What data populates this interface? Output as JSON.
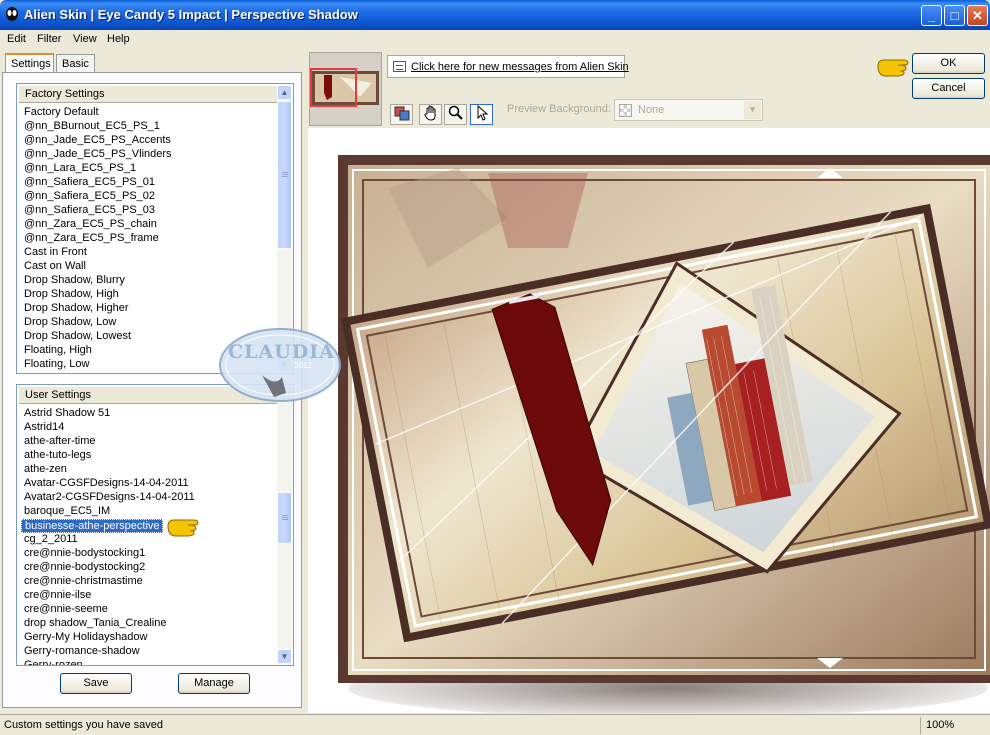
{
  "window": {
    "title": "Alien Skin  |  Eye Candy 5 Impact  |  Perspective Shadow",
    "minimize": "_",
    "maximize": "□",
    "close": "✕"
  },
  "menu": [
    "Edit",
    "Filter",
    "View",
    "Help"
  ],
  "tabs": [
    "Settings",
    "Basic"
  ],
  "factory_settings": {
    "header": "Factory Settings",
    "items": [
      "Factory Default",
      "@nn_BBurnout_EC5_PS_1",
      "@nn_Jade_EC5_PS_Accents",
      "@nn_Jade_EC5_PS_Vlinders",
      "@nn_Lara_EC5_PS_1",
      "@nn_Safiera_EC5_PS_01",
      "@nn_Safiera_EC5_PS_02",
      "@nn_Safiera_EC5_PS_03",
      "@nn_Zara_EC5_PS_chain",
      "@nn_Zara_EC5_PS_frame",
      "Cast in Front",
      "Cast on Wall",
      "Drop Shadow, Blurry",
      "Drop Shadow, High",
      "Drop Shadow, Higher",
      "Drop Shadow, Low",
      "Drop Shadow, Lowest",
      "Floating, High",
      "Floating, Low"
    ]
  },
  "user_settings": {
    "header": "User Settings",
    "items": [
      "Astrid Shadow 51",
      "Astrid14",
      "athe-after-time",
      "athe-tuto-legs",
      "athe-zen",
      "Avatar-CGSFDesigns-14-04-2011",
      "Avatar2-CGSFDesigns-14-04-2011",
      "baroque_EC5_IM",
      "businesse-athe-perspective",
      "cg_2_2011",
      "cre@nnie-bodystocking1",
      "cre@nnie-bodystocking2",
      "cre@nnie-christmastime",
      "cre@nnie-ilse",
      "cre@nnie-seeme",
      "drop shadow_Tania_Crealine",
      "Gerry-My Holidayshadow",
      "Gerry-romance-shadow",
      "Gerry-rozen"
    ],
    "selected_index": 8
  },
  "buttons": {
    "save": "Save",
    "manage": "Manage",
    "ok": "OK",
    "cancel": "Cancel"
  },
  "messages_link": "Click here for new messages from Alien Skin",
  "preview_background": {
    "label": "Preview Background:",
    "value": "None"
  },
  "status": {
    "text": "Custom settings you have saved",
    "zoom": "100%"
  },
  "watermark": {
    "text": "CLAUDIA",
    "year": "2012"
  },
  "colors": {
    "title_blue": "#0a50c8",
    "selection": "#316ac5",
    "frame_brown": "#5a3a30",
    "ribbon_red": "#6b0a08",
    "pointer_yellow": "#f5c400"
  }
}
